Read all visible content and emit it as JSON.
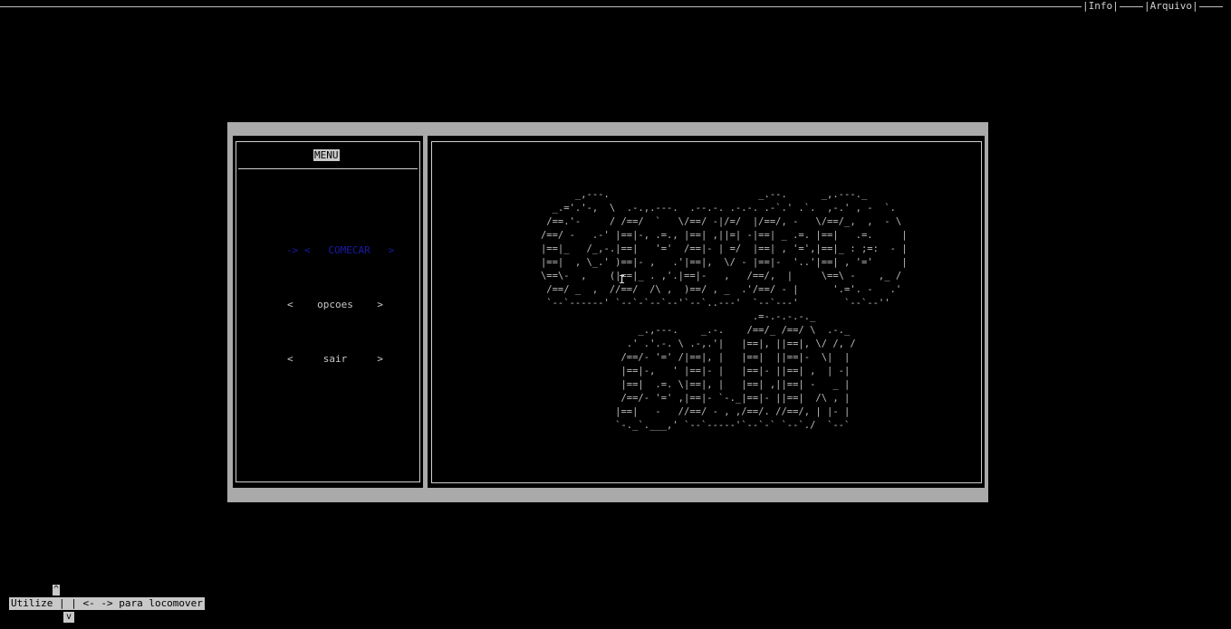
{
  "topbar": {
    "menu_items": [
      "Info",
      "Arquivo"
    ]
  },
  "menu": {
    "title": "MENU",
    "options": [
      {
        "label": "-> <   COMECAR   >",
        "selected": true
      },
      {
        "label": "<    opcoes    >",
        "selected": false
      },
      {
        "label": "<     sair     >",
        "selected": false
      }
    ]
  },
  "art": {
    "lines": [
      "         _,---.                          _.--.      _,.---._      ",
      "     _.='.'-,  \\  .-.,.---.  .--.-. .-.-. .-`.' .`.  ,-.' , -  `.  ",
      "    /==.'-     / /==/  `   \\/==/ -|/=/  |/==/, -   \\/==/_,  ,  - \\ ",
      "   /==/ -   .-' |==|-, .=., |==| ,||=| -|==| _ .=. |==|   .=.     |",
      "   |==|_   /_,-.|==|   '='  /==|- | =/  |==| , '=',|==|_ : ;=:  - |",
      "   |==|  , \\_.' )==|- ,   .'|==|,  \\/ - |==|-  '..'|==| , '='     |",
      "   \\==\\-  ,    (|==|_ . ,'.|==|-   ,   /==/,  |     \\==\\ -    ,_ / ",
      "    /==/ _  ,  //==/  /\\ ,  )==/ , _  .'/==/ - |      '.='. -   .'  ",
      "    `--`------' `--`-`--`--'`--`..---'  `--`---'        `--`--''    ",
      "                                        .=-.-.-.-._",
      "                    _.,---.    _.-.    /==/_ /==/ \\  .-._",
      "                  .' .'.-. \\ .-,.'|   |==|, ||==|, \\/ /, /",
      "                 /==/- '=' /|==|, |   |==|  ||==|-  \\|  |",
      "                 |==|-,   ' |==|- |   |==|- ||==| ,  | -|",
      "                 |==|  .=. \\|==|, |   |==| ,||==| -   _ |",
      "                 /==/- '=' ,|==|- `-._|==|- ||==|  /\\ , |",
      "                |==|   -   //==/ - , ,/==/. //==/, | |- |",
      "                `-._`.___,' `--`-----'`--`-` `--`./  `--`"
    ]
  },
  "hint": {
    "text": "Utilize | | <- -> para locomover",
    "up_arrow": "^",
    "down_arrow": "v"
  }
}
